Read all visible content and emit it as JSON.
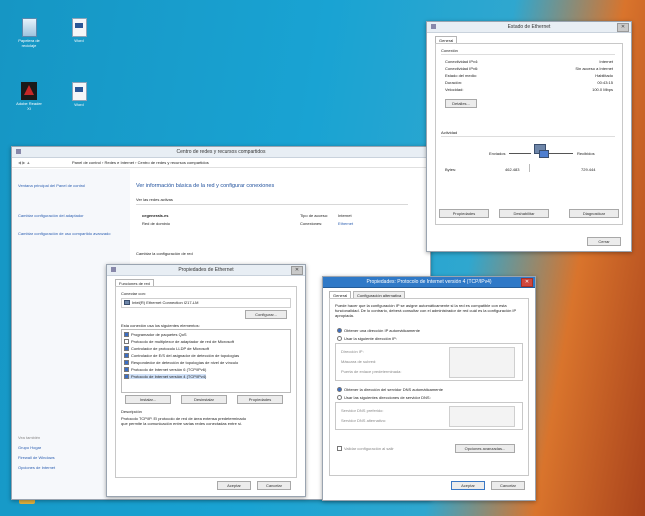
{
  "desktop": {
    "icons": [
      {
        "label": "Papelera de reciclaje"
      },
      {
        "label": "Word"
      },
      {
        "label": "Adobe Reader XI"
      },
      {
        "label": "Word"
      }
    ]
  },
  "network_center": {
    "title": "Centro de redes y recursos compartidos",
    "breadcrumb": "Panel de control  ›  Redes e Internet  ›  Centro de redes y recursos compartidos",
    "search_placeholder": "Buscar en el Panel de control",
    "sidebar_links": [
      "Ventana principal del Panel de control",
      "Cambiar configuración del adaptador",
      "Cambiar configuración de uso compartido avanzado"
    ],
    "see_also_title": "Vea también",
    "see_also_links": [
      "Grupo Hogar",
      "Firewall de Windows",
      "Opciones de Internet"
    ],
    "heading": "Ver información básica de la red y configurar conexiones",
    "active_networks_label": "Ver las redes activas",
    "network_name": "cegenerals.es",
    "network_type": "Red de dominio",
    "access_type_label": "Tipo de acceso:",
    "access_type_value": "Internet",
    "connections_label": "Conexiones:",
    "connections_value": "Ethernet",
    "change_settings_label": "Cambiar la configuración de red"
  },
  "ethernet_status": {
    "title": "Estado de Ethernet",
    "tab": "General",
    "connection_group": "Conexión",
    "rows": [
      {
        "label": "Conectividad IPv4:",
        "value": "Internet"
      },
      {
        "label": "Conectividad IPv6:",
        "value": "Sin acceso a Internet"
      },
      {
        "label": "Estado del medio:",
        "value": "Habilitado"
      },
      {
        "label": "Duración:",
        "value": "00:43:15"
      },
      {
        "label": "Velocidad:",
        "value": "100.0 Mbps"
      }
    ],
    "details_button": "Detalles...",
    "activity_group": "Actividad",
    "sent_label": "Enviados",
    "received_label": "Recibidos",
    "bytes_label": "Bytes:",
    "bytes_sent": "462.483",
    "bytes_received": "729.444",
    "properties_button": "Propiedades",
    "disable_button": "Deshabilitar",
    "diagnose_button": "Diagnosticar",
    "close_button": "Cerrar"
  },
  "eth_properties": {
    "title": "Propiedades de Ethernet",
    "tab": "Funciones de red",
    "connect_using_label": "Conectar con:",
    "adapter_name": "Intel(R) Ethernet Connection I217-LM",
    "configure_button": "Configurar...",
    "items_label": "Esta conexión usa los siguientes elementos:",
    "items": [
      {
        "label": "Programador de paquetes QoS",
        "checked": true
      },
      {
        "label": "Protocolo de multiplexor de adaptador de red de Microsoft",
        "checked": false
      },
      {
        "label": "Controlador de protocolo LLDP de Microsoft",
        "checked": true
      },
      {
        "label": "Controlador de E/S del asignador de detección de topologías",
        "checked": true
      },
      {
        "label": "Respondedor de detección de topologías de nivel de vínculo",
        "checked": true
      },
      {
        "label": "Protocolo de Internet versión 6 (TCP/IPv6)",
        "checked": true
      },
      {
        "label": "Protocolo de Internet versión 4 (TCP/IPv4)",
        "checked": true
      }
    ],
    "install_button": "Instalar...",
    "uninstall_button": "Desinstalar",
    "properties_button": "Propiedades",
    "description_label": "Descripción",
    "description_text": "Protocolo TCP/IP. El protocolo de red de área extensa predeterminado que permite la comunicación entre varias redes conectadas entre sí.",
    "ok_button": "Aceptar",
    "cancel_button": "Cancelar"
  },
  "ipv4_properties": {
    "title": "Propiedades: Protocolo de Internet versión 4 (TCP/IPv4)",
    "tab_general": "General",
    "tab_alt": "Configuración alternativa",
    "intro": "Puede hacer que la configuración IP se asigne automáticamente si la red es compatible con esta funcionalidad. De lo contrario, deberá consultar con el administrador de red cuál es la configuración IP apropiada.",
    "auto_ip": "Obtener una dirección IP automáticamente",
    "manual_ip": "Usar la siguiente dirección IP:",
    "ip_label": "Dirección IP:",
    "mask_label": "Máscara de subred:",
    "gateway_label": "Puerta de enlace predeterminada:",
    "auto_dns": "Obtener la dirección del servidor DNS automáticamente",
    "manual_dns": "Usar las siguientes direcciones de servidor DNS:",
    "pref_dns_label": "Servidor DNS preferido:",
    "alt_dns_label": "Servidor DNS alternativo:",
    "validate_label": "Validar configuración al salir",
    "advanced_button": "Opciones avanzadas...",
    "ok_button": "Aceptar",
    "cancel_button": "Cancelar"
  }
}
